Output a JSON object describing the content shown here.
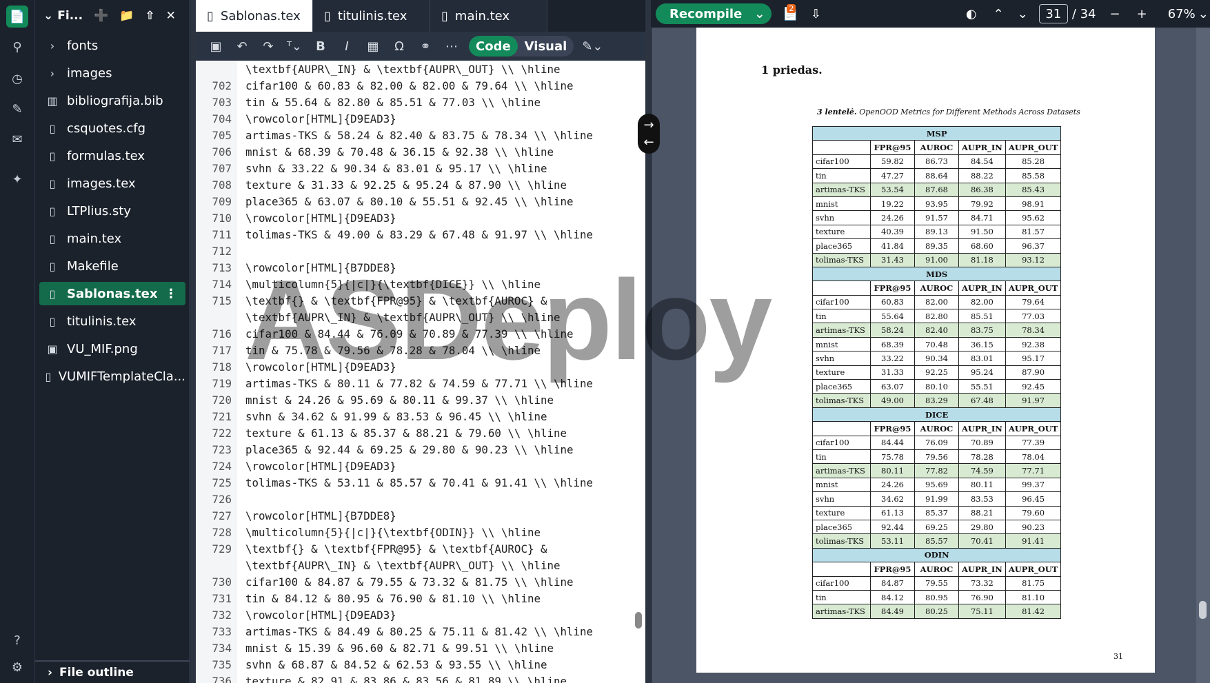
{
  "sidebar_rail": {
    "icons": [
      "file-icon",
      "search-icon",
      "history-icon",
      "review-icon",
      "chat-icon",
      "ai-assist-icon",
      "help-icon",
      "settings-icon"
    ]
  },
  "file_tree": {
    "title": "Fi...",
    "items": [
      {
        "label": "fonts",
        "icon": "chevron-right-icon"
      },
      {
        "label": "images",
        "icon": "chevron-right-icon"
      },
      {
        "label": "bibliografija.bib",
        "icon": "book-icon"
      },
      {
        "label": "csquotes.cfg",
        "icon": "file-icon"
      },
      {
        "label": "formulas.tex",
        "icon": "file-icon"
      },
      {
        "label": "images.tex",
        "icon": "file-icon"
      },
      {
        "label": "LTPlius.sty",
        "icon": "file-icon"
      },
      {
        "label": "main.tex",
        "icon": "file-icon"
      },
      {
        "label": "Makefile",
        "icon": "file-icon"
      },
      {
        "label": "Sablonas.tex",
        "icon": "file-icon",
        "selected": true
      },
      {
        "label": "titulinis.tex",
        "icon": "file-icon"
      },
      {
        "label": "VU_MIF.png",
        "icon": "image-icon"
      },
      {
        "label": "VUMIFTemplateCla...",
        "icon": "file-icon"
      }
    ],
    "outline_label": "File outline"
  },
  "editor": {
    "tabs": [
      {
        "label": "Sablonas.tex",
        "active": true
      },
      {
        "label": "titulinis.tex",
        "active": false
      },
      {
        "label": "main.tex",
        "active": false
      }
    ],
    "mode_code": "Code",
    "mode_visual": "Visual",
    "lines": [
      {
        "n": "",
        "t": "\\textbf{AUPR\\_IN} & \\textbf{AUPR\\_OUT} \\\\ \\hline"
      },
      {
        "n": "702",
        "t": "cifar100 & 60.83 & 82.00 & 82.00 & 79.64 \\\\ \\hline"
      },
      {
        "n": "703",
        "t": "tin & 55.64 & 82.80 & 85.51 & 77.03 \\\\ \\hline"
      },
      {
        "n": "704",
        "t": "\\rowcolor[HTML]{D9EAD3}"
      },
      {
        "n": "705",
        "t": "artimas-TKS & 58.24 & 82.40 & 83.75 & 78.34 \\\\ \\hline"
      },
      {
        "n": "706",
        "t": "mnist & 68.39 & 70.48 & 36.15 & 92.38 \\\\ \\hline"
      },
      {
        "n": "707",
        "t": "svhn & 33.22 & 90.34 & 83.01 & 95.17 \\\\ \\hline"
      },
      {
        "n": "708",
        "t": "texture & 31.33 & 92.25 & 95.24 & 87.90 \\\\ \\hline"
      },
      {
        "n": "709",
        "t": "place365 & 63.07 & 80.10 & 55.51 & 92.45 \\\\ \\hline"
      },
      {
        "n": "710",
        "t": "\\rowcolor[HTML]{D9EAD3}"
      },
      {
        "n": "711",
        "t": "tolimas-TKS & 49.00 & 83.29 & 67.48 & 91.97 \\\\ \\hline"
      },
      {
        "n": "712",
        "t": ""
      },
      {
        "n": "713",
        "t": "\\rowcolor[HTML]{B7DDE8}"
      },
      {
        "n": "714",
        "t": "\\multicolumn{5}{|c|}{\\textbf{DICE}} \\\\ \\hline"
      },
      {
        "n": "715",
        "t": "\\textbf{} & \\textbf{FPR@95} & \\textbf{AUROC} &"
      },
      {
        "n": "",
        "t": "\\textbf{AUPR\\_IN} & \\textbf{AUPR\\_OUT} \\\\ \\hline"
      },
      {
        "n": "716",
        "t": "cifar100 & 84.44 & 76.09 & 70.89 & 77.39 \\\\ \\hline"
      },
      {
        "n": "717",
        "t": "tin & 75.78 & 79.56 & 78.28 & 78.04 \\\\ \\hline"
      },
      {
        "n": "718",
        "t": "\\rowcolor[HTML]{D9EAD3}"
      },
      {
        "n": "719",
        "t": "artimas-TKS & 80.11 & 77.82 & 74.59 & 77.71 \\\\ \\hline"
      },
      {
        "n": "720",
        "t": "mnist & 24.26 & 95.69 & 80.11 & 99.37 \\\\ \\hline"
      },
      {
        "n": "721",
        "t": "svhn & 34.62 & 91.99 & 83.53 & 96.45 \\\\ \\hline"
      },
      {
        "n": "722",
        "t": "texture & 61.13 & 85.37 & 88.21 & 79.60 \\\\ \\hline"
      },
      {
        "n": "723",
        "t": "place365 & 92.44 & 69.25 & 29.80 & 90.23 \\\\ \\hline"
      },
      {
        "n": "724",
        "t": "\\rowcolor[HTML]{D9EAD3}"
      },
      {
        "n": "725",
        "t": "tolimas-TKS & 53.11 & 85.57 & 70.41 & 91.41 \\\\ \\hline"
      },
      {
        "n": "726",
        "t": ""
      },
      {
        "n": "727",
        "t": "\\rowcolor[HTML]{B7DDE8}"
      },
      {
        "n": "728",
        "t": "\\multicolumn{5}{|c|}{\\textbf{ODIN}} \\\\ \\hline"
      },
      {
        "n": "729",
        "t": "\\textbf{} & \\textbf{FPR@95} & \\textbf{AUROC} &"
      },
      {
        "n": "",
        "t": "\\textbf{AUPR\\_IN} & \\textbf{AUPR\\_OUT} \\\\ \\hline"
      },
      {
        "n": "730",
        "t": "cifar100 & 84.87 & 79.55 & 73.32 & 81.75 \\\\ \\hline"
      },
      {
        "n": "731",
        "t": "tin & 84.12 & 80.95 & 76.90 & 81.10 \\\\ \\hline"
      },
      {
        "n": "732",
        "t": "\\rowcolor[HTML]{D9EAD3}"
      },
      {
        "n": "733",
        "t": "artimas-TKS & 84.49 & 80.25 & 75.11 & 81.42 \\\\ \\hline"
      },
      {
        "n": "734",
        "t": "mnist & 15.39 & 96.60 & 82.71 & 99.51 \\\\ \\hline"
      },
      {
        "n": "735",
        "t": "svhn & 68.87 & 84.52 & 62.53 & 93.55 \\\\ \\hline"
      },
      {
        "n": "736",
        "t": "texture & 82.91 & 83.86 & 83.56 & 81.89 \\\\ \\hline"
      }
    ]
  },
  "pdf": {
    "recompile_label": "Recompile",
    "badge": "2",
    "page_current": "31",
    "page_total": "/ 34",
    "zoom": "67%",
    "heading": "1 priedas.",
    "caption_bold": "3 lentelė.",
    "caption_text": "OpenOOD Metrics for Different Methods Across Datasets",
    "column_headers": [
      "",
      "FPR@95",
      "AUROC",
      "AUPR_IN",
      "AUPR_OUT"
    ],
    "sections": [
      {
        "name": "MSP",
        "rows": [
          {
            "c": [
              "cifar100",
              "59.82",
              "86.73",
              "84.54",
              "85.28"
            ],
            "g": false
          },
          {
            "c": [
              "tin",
              "47.27",
              "88.64",
              "88.22",
              "85.58"
            ],
            "g": false
          },
          {
            "c": [
              "artimas-TKS",
              "53.54",
              "87.68",
              "86.38",
              "85.43"
            ],
            "g": true
          },
          {
            "c": [
              "mnist",
              "19.22",
              "93.95",
              "79.92",
              "98.91"
            ],
            "g": false
          },
          {
            "c": [
              "svhn",
              "24.26",
              "91.57",
              "84.71",
              "95.62"
            ],
            "g": false
          },
          {
            "c": [
              "texture",
              "40.39",
              "89.13",
              "91.50",
              "81.57"
            ],
            "g": false
          },
          {
            "c": [
              "place365",
              "41.84",
              "89.35",
              "68.60",
              "96.37"
            ],
            "g": false
          },
          {
            "c": [
              "tolimas-TKS",
              "31.43",
              "91.00",
              "81.18",
              "93.12"
            ],
            "g": true
          }
        ]
      },
      {
        "name": "MDS",
        "rows": [
          {
            "c": [
              "cifar100",
              "60.83",
              "82.00",
              "82.00",
              "79.64"
            ],
            "g": false
          },
          {
            "c": [
              "tin",
              "55.64",
              "82.80",
              "85.51",
              "77.03"
            ],
            "g": false
          },
          {
            "c": [
              "artimas-TKS",
              "58.24",
              "82.40",
              "83.75",
              "78.34"
            ],
            "g": true
          },
          {
            "c": [
              "mnist",
              "68.39",
              "70.48",
              "36.15",
              "92.38"
            ],
            "g": false
          },
          {
            "c": [
              "svhn",
              "33.22",
              "90.34",
              "83.01",
              "95.17"
            ],
            "g": false
          },
          {
            "c": [
              "texture",
              "31.33",
              "92.25",
              "95.24",
              "87.90"
            ],
            "g": false
          },
          {
            "c": [
              "place365",
              "63.07",
              "80.10",
              "55.51",
              "92.45"
            ],
            "g": false
          },
          {
            "c": [
              "tolimas-TKS",
              "49.00",
              "83.29",
              "67.48",
              "91.97"
            ],
            "g": true
          }
        ]
      },
      {
        "name": "DICE",
        "rows": [
          {
            "c": [
              "cifar100",
              "84.44",
              "76.09",
              "70.89",
              "77.39"
            ],
            "g": false
          },
          {
            "c": [
              "tin",
              "75.78",
              "79.56",
              "78.28",
              "78.04"
            ],
            "g": false
          },
          {
            "c": [
              "artimas-TKS",
              "80.11",
              "77.82",
              "74.59",
              "77.71"
            ],
            "g": true
          },
          {
            "c": [
              "mnist",
              "24.26",
              "95.69",
              "80.11",
              "99.37"
            ],
            "g": false
          },
          {
            "c": [
              "svhn",
              "34.62",
              "91.99",
              "83.53",
              "96.45"
            ],
            "g": false
          },
          {
            "c": [
              "texture",
              "61.13",
              "85.37",
              "88.21",
              "79.60"
            ],
            "g": false
          },
          {
            "c": [
              "place365",
              "92.44",
              "69.25",
              "29.80",
              "90.23"
            ],
            "g": false
          },
          {
            "c": [
              "tolimas-TKS",
              "53.11",
              "85.57",
              "70.41",
              "91.41"
            ],
            "g": true
          }
        ]
      },
      {
        "name": "ODIN",
        "rows": [
          {
            "c": [
              "cifar100",
              "84.87",
              "79.55",
              "73.32",
              "81.75"
            ],
            "g": false
          },
          {
            "c": [
              "tin",
              "84.12",
              "80.95",
              "76.90",
              "81.10"
            ],
            "g": false
          },
          {
            "c": [
              "artimas-TKS",
              "84.49",
              "80.25",
              "75.11",
              "81.42"
            ],
            "g": true
          }
        ]
      }
    ],
    "page_number": "31"
  },
  "watermark": "ASDeploy",
  "colors": {
    "accent": "#138a5a",
    "header_row": "#B7DDE8",
    "green_row": "#D9EAD3"
  }
}
